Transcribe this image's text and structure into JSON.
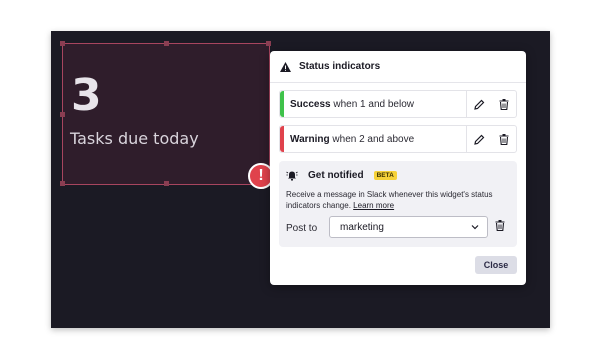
{
  "widget": {
    "value": "3",
    "label": "Tasks due today",
    "alert_symbol": "!"
  },
  "panel": {
    "title": "Status indicators",
    "title_icon": "warning-icon",
    "rules": [
      {
        "name": "Success",
        "condition": "when 1 and below",
        "color": "#3fc24a"
      },
      {
        "name": "Warning",
        "condition": "when 2 and above",
        "color": "#e0424c"
      }
    ],
    "notify": {
      "title": "Get notified",
      "badge": "BETA",
      "description": "Receive a message in Slack whenever this widget's status indicators change.",
      "link_text": "Learn more",
      "post_label": "Post to",
      "channel": "marketing"
    },
    "close_label": "Close"
  }
}
